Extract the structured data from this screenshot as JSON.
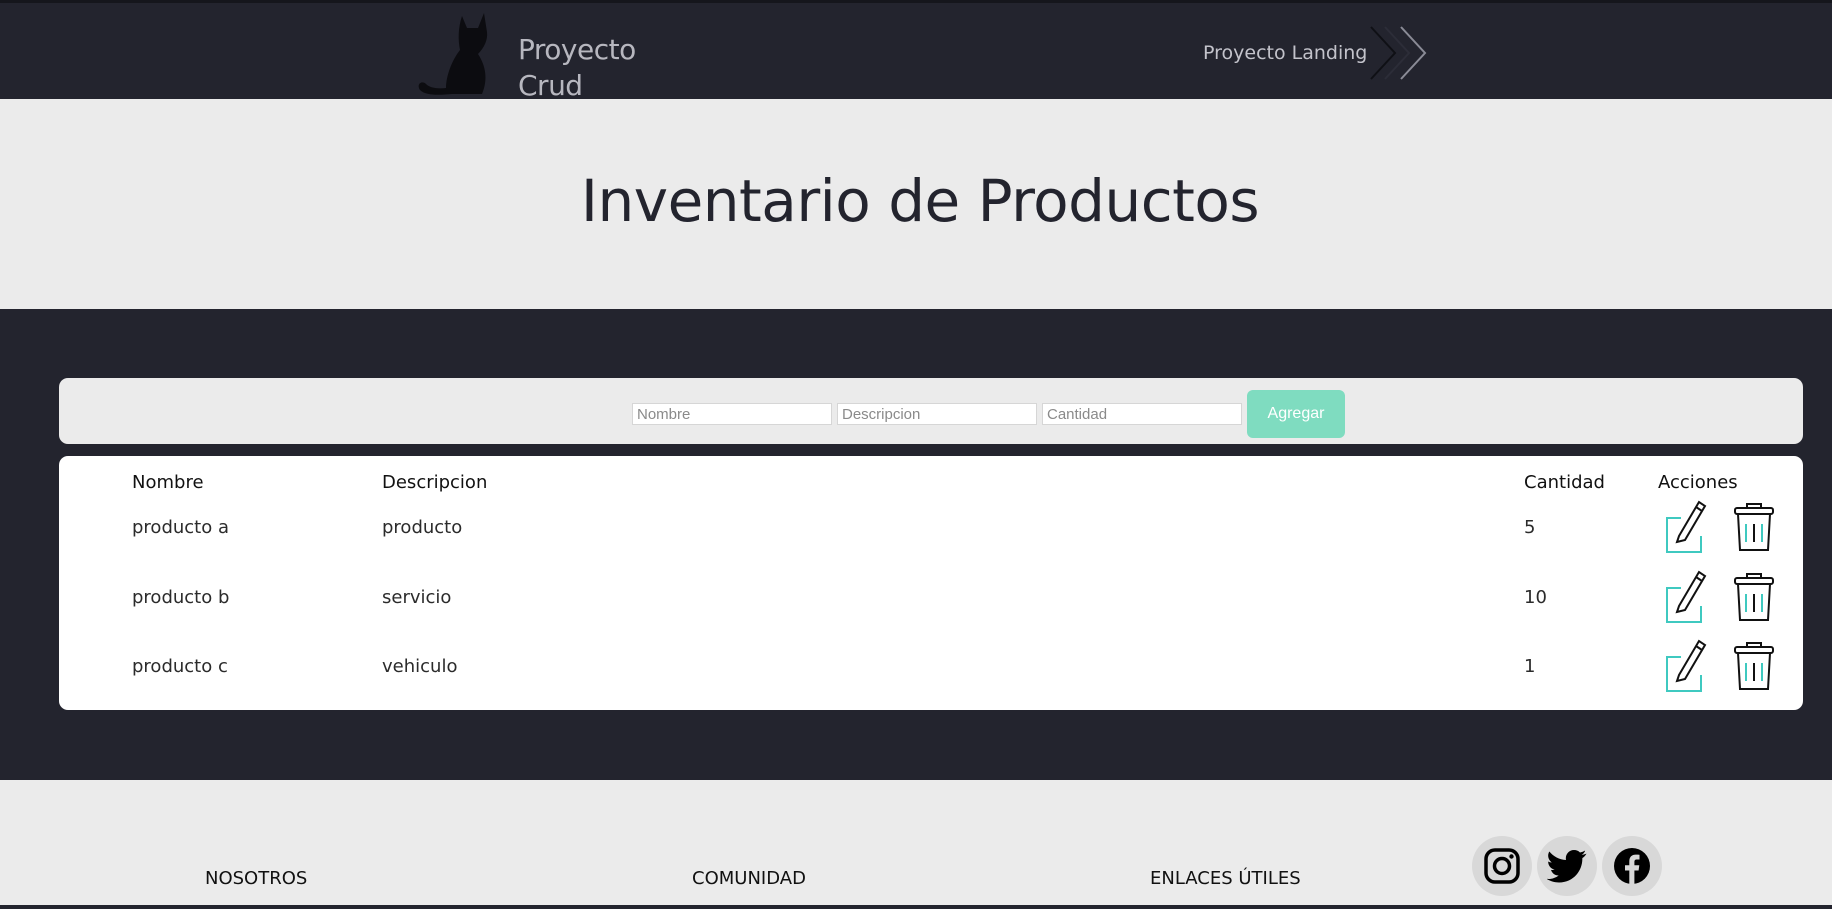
{
  "header": {
    "brand_line1": "Proyecto",
    "brand_line2": "Crud",
    "landing_link": "Proyecto Landing"
  },
  "hero": {
    "title": "Inventario de Productos"
  },
  "form": {
    "nombre_placeholder": "Nombre",
    "descripcion_placeholder": "Descripcion",
    "cantidad_placeholder": "Cantidad",
    "add_label": "Agregar"
  },
  "table": {
    "headers": {
      "nombre": "Nombre",
      "descripcion": "Descripcion",
      "cantidad": "Cantidad",
      "acciones": "Acciones"
    },
    "rows": [
      {
        "nombre": "producto a",
        "descripcion": "producto",
        "cantidad": "5"
      },
      {
        "nombre": "producto b",
        "descripcion": "servicio",
        "cantidad": "10"
      },
      {
        "nombre": "producto c",
        "descripcion": "vehiculo",
        "cantidad": "1"
      }
    ]
  },
  "footer": {
    "links": [
      "NOSOTROS",
      "COMUNIDAD",
      "ENLACES ÚTILES"
    ],
    "social": [
      "instagram-icon",
      "twitter-icon",
      "facebook-icon"
    ]
  },
  "colors": {
    "dark": "#23242e",
    "light": "#ebebeb",
    "accent": "#7fdcc0",
    "icon_accent": "#3fc9c0"
  }
}
